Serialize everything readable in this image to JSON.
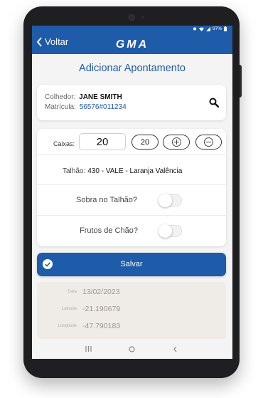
{
  "status": {
    "battery": "97%"
  },
  "appbar": {
    "back_label": "Voltar",
    "logo_text": "GMA"
  },
  "page": {
    "title": "Adicionar Apontamento"
  },
  "person": {
    "colhedor_label": "Colhedor:",
    "colhedor_name": "JANE SMITH",
    "matricula_label": "Matrícula:",
    "matricula_value": "56576#011234"
  },
  "form": {
    "caixas_label": "Caixas:",
    "caixas_value": "20",
    "caixas_pill_value": "20",
    "talhao_label": "Talhão:",
    "talhao_value": "430 - VALE - Laranja Valência",
    "sobra_label": "Sobra no Talhão?",
    "sobra_checked": false,
    "frutos_label": "Frutos de Chão?",
    "frutos_checked": false
  },
  "actions": {
    "save_label": "Salvar"
  },
  "info": {
    "date_label": "Data",
    "date_value": "13/02/2023",
    "lat_label": "Latitude",
    "lat_value": "-21.190679",
    "lon_label": "Longitude",
    "lon_value": "-47.790183"
  },
  "colors": {
    "primary": "#1e5ba8",
    "background": "#f4f4f4",
    "info_bg": "#efece7"
  },
  "icons": [
    "back-chevron-icon",
    "search-icon",
    "plus-circle-icon",
    "minus-circle-icon",
    "check-circle-icon",
    "recents-icon",
    "home-icon",
    "nav-back-icon"
  ]
}
